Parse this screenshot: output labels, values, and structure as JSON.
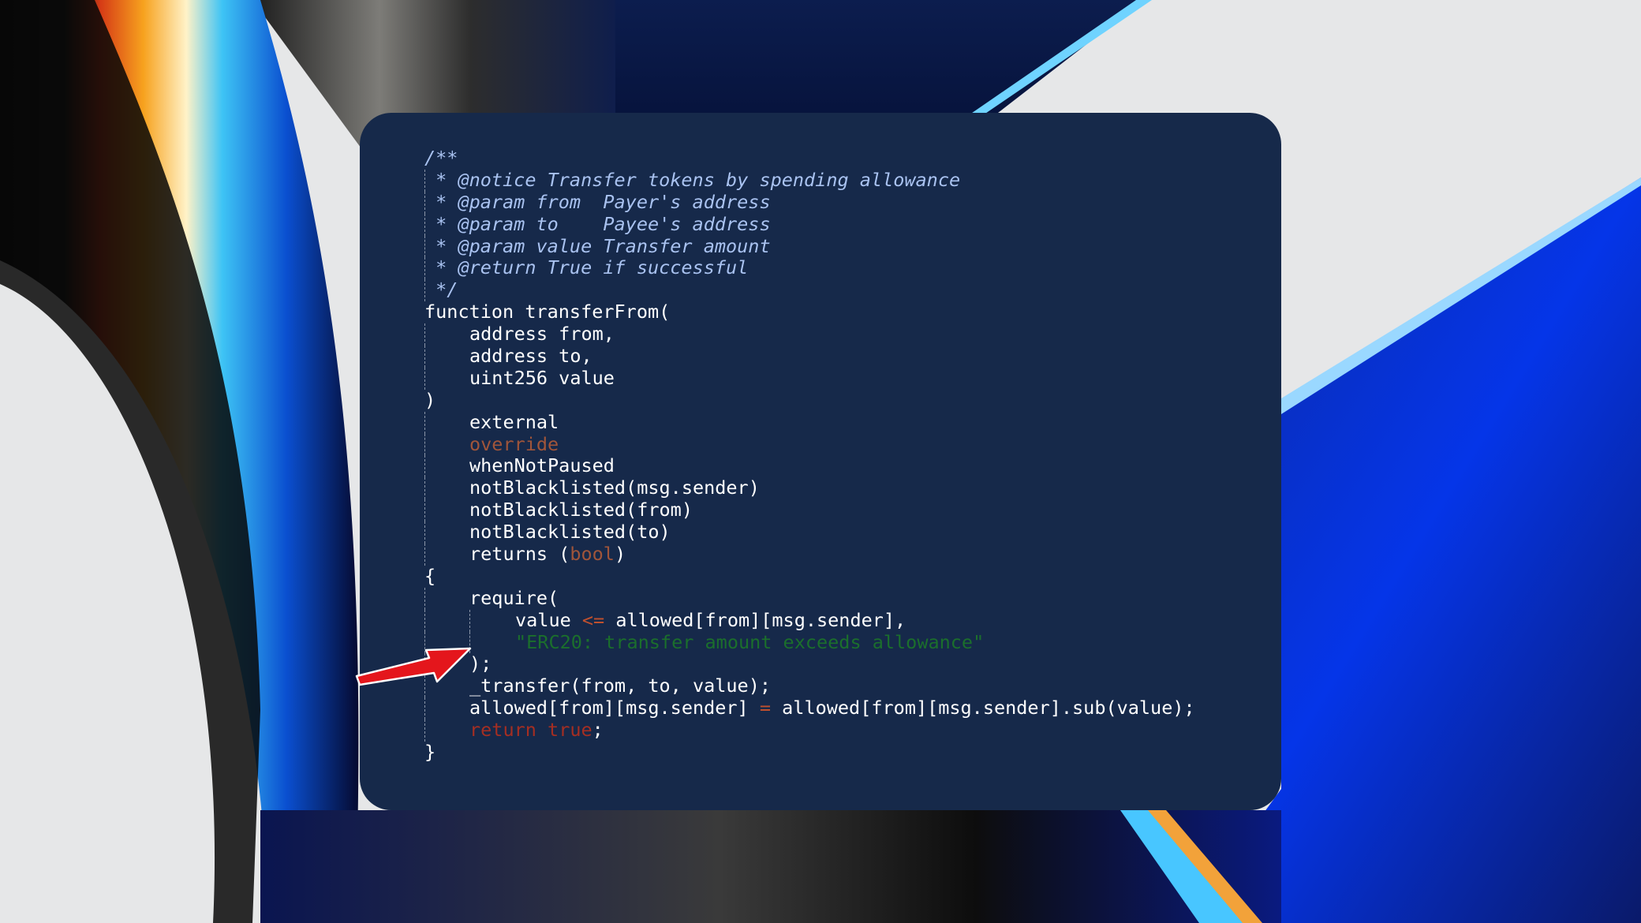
{
  "code_card": {
    "background_color": "#16294a",
    "lines": [
      "/**",
      " * @notice Transfer tokens by spending allowance",
      " * @param from  Payer's address",
      " * @param to    Payee's address",
      " * @param value Transfer amount",
      " * @return True if successful",
      " */",
      "function transferFrom(",
      "address from,",
      "address to,",
      "uint256 value",
      ")",
      "external",
      "override",
      "whenNotPaused",
      "notBlacklisted(msg.sender)",
      "notBlacklisted(from)",
      "notBlacklisted(to)",
      "returns (",
      "bool",
      ")",
      "{",
      "require(",
      "value ",
      "<=",
      " allowed[from][msg.sender],",
      "\"ERC20: transfer amount exceeds allowance\"",
      ");",
      "_transfer(from, to, value);",
      "allowed[from][msg.sender] ",
      "=",
      " allowed[from][msg.sender].sub(value);",
      "return",
      " ",
      "true",
      ";",
      "}"
    ]
  },
  "colors": {
    "comment": "#a9c2f0",
    "string": "#1b6f2c",
    "keyword_return": "#a52e22",
    "modifier_override": "#a0553a",
    "arrow": "#e4161c"
  },
  "annotation": {
    "icon": "red-arrow-icon"
  }
}
